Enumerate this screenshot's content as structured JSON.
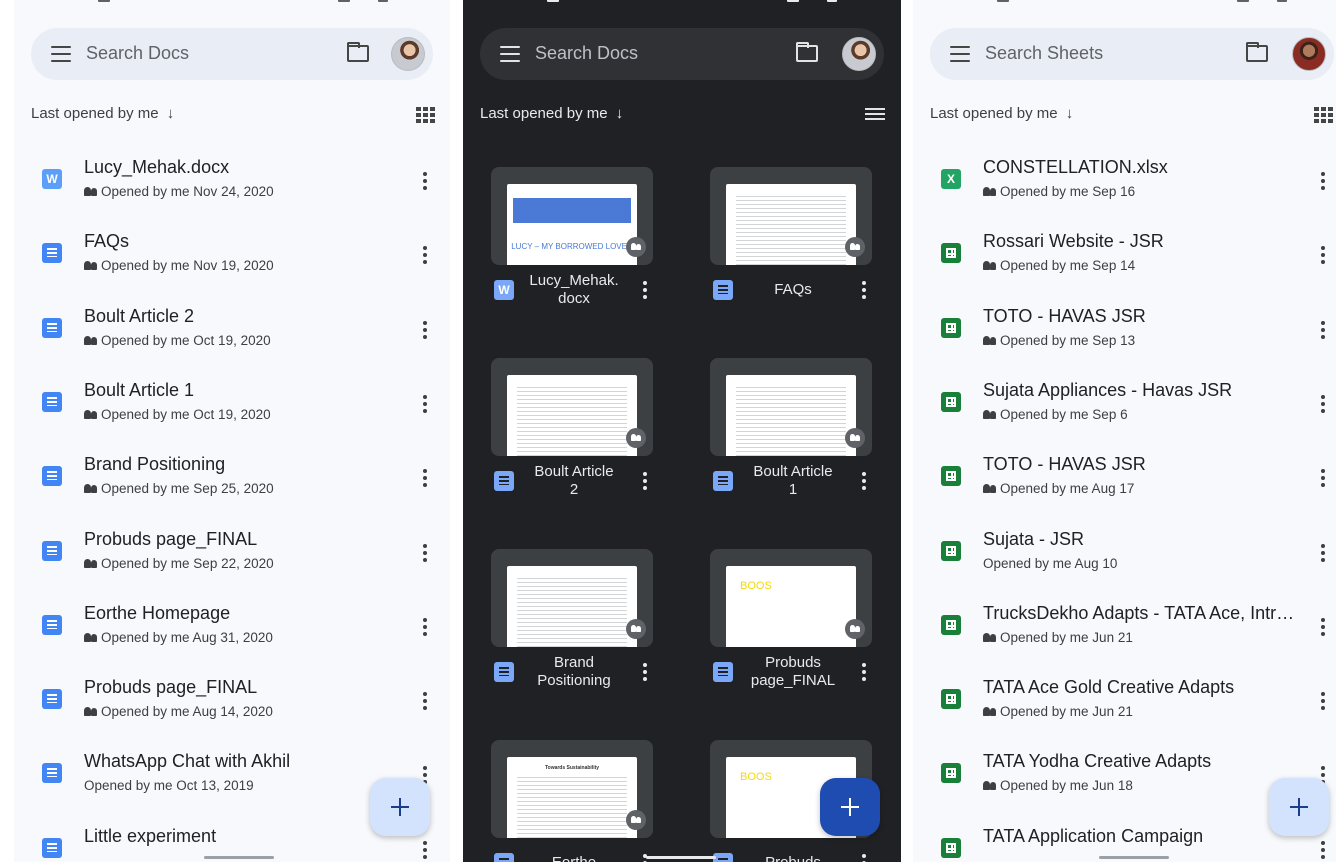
{
  "panel1": {
    "search_placeholder": "Search Docs",
    "sort_label": "Last opened by me",
    "sort_arrow": "↓",
    "files": [
      {
        "title": "Lucy_Mehak.docx",
        "subtitle": "Opened by me Nov 24, 2020",
        "icon": "word-icon",
        "icon_letter": "W",
        "shared": true
      },
      {
        "title": "FAQs",
        "subtitle": "Opened by me Nov 19, 2020",
        "icon": "doc-icon",
        "shared": true
      },
      {
        "title": "Boult Article 2",
        "subtitle": "Opened by me Oct 19, 2020",
        "icon": "doc-icon",
        "shared": true
      },
      {
        "title": "Boult Article 1",
        "subtitle": "Opened by me Oct 19, 2020",
        "icon": "doc-icon",
        "shared": true
      },
      {
        "title": "Brand Positioning",
        "subtitle": "Opened by me Sep 25, 2020",
        "icon": "doc-icon",
        "shared": true
      },
      {
        "title": "Probuds page_FINAL",
        "subtitle": "Opened by me Sep 22, 2020",
        "icon": "doc-icon",
        "shared": true
      },
      {
        "title": "Eorthe Homepage",
        "subtitle": "Opened by me Aug 31, 2020",
        "icon": "doc-icon",
        "shared": true
      },
      {
        "title": "Probuds page_FINAL",
        "subtitle": "Opened by me Aug 14, 2020",
        "icon": "doc-icon",
        "shared": true
      },
      {
        "title": "WhatsApp Chat with Akhil",
        "subtitle": "Opened by me Oct 13, 2019",
        "icon": "doc-icon",
        "shared": false
      },
      {
        "title": "Little experiment",
        "subtitle": "",
        "icon": "doc-icon",
        "shared": true
      }
    ]
  },
  "panel2": {
    "search_placeholder": "Search Docs",
    "sort_label": "Last opened by me",
    "sort_arrow": "↓",
    "cards": [
      {
        "title_lines": [
          "Lucy_Mehak.",
          "docx"
        ],
        "icon_letter": "W",
        "icon": "word-icon",
        "thumb_caption": "LUCY – MY BORROWED LOVER"
      },
      {
        "title_lines": [
          "FAQs"
        ],
        "icon": "doc-icon"
      },
      {
        "title_lines": [
          "Boult Article",
          "2"
        ],
        "icon": "doc-icon"
      },
      {
        "title_lines": [
          "Boult Article",
          "1"
        ],
        "icon": "doc-icon"
      },
      {
        "title_lines": [
          "Brand",
          "Positioning"
        ],
        "icon": "doc-icon"
      },
      {
        "title_lines": [
          "Probuds",
          "page_FINAL"
        ],
        "icon": "doc-icon",
        "thumb_text": "BOOS"
      },
      {
        "title_lines": [
          "Eorthe"
        ],
        "icon": "doc-icon",
        "thumb_heading": "Towards Sustainability"
      },
      {
        "title_lines": [
          "Probuds"
        ],
        "icon": "doc-icon",
        "thumb_text": "BOOS"
      }
    ]
  },
  "panel3": {
    "search_placeholder": "Search Sheets",
    "sort_label": "Last opened by me",
    "sort_arrow": "↓",
    "files": [
      {
        "title": "CONSTELLATION.xlsx",
        "subtitle": "Opened by me Sep 16",
        "icon": "excel-icon",
        "icon_letter": "X",
        "shared": true
      },
      {
        "title": "Rossari Website - JSR",
        "subtitle": "Opened by me Sep 14",
        "icon": "sheet-icon",
        "shared": true
      },
      {
        "title": "TOTO - HAVAS JSR",
        "subtitle": "Opened by me Sep 13",
        "icon": "sheet-icon",
        "shared": true
      },
      {
        "title": "Sujata Appliances - Havas JSR",
        "subtitle": "Opened by me Sep 6",
        "icon": "sheet-icon",
        "shared": true
      },
      {
        "title": "TOTO - HAVAS JSR",
        "subtitle": "Opened by me Aug 17",
        "icon": "sheet-icon",
        "shared": true
      },
      {
        "title": "Sujata - JSR",
        "subtitle": "Opened by me Aug 10",
        "icon": "sheet-icon",
        "shared": false
      },
      {
        "title": "TrucksDekho Adapts - TATA Ace, Intra ...",
        "subtitle": "Opened by me Jun 21",
        "icon": "sheet-icon",
        "shared": true
      },
      {
        "title": "TATA Ace Gold Creative Adapts",
        "subtitle": "Opened by me Jun 21",
        "icon": "sheet-icon",
        "shared": true
      },
      {
        "title": "TATA Yodha Creative Adapts",
        "subtitle": "Opened by me Jun 18",
        "icon": "sheet-icon",
        "shared": true
      },
      {
        "title": "TATA Application Campaign",
        "subtitle": "",
        "icon": "sheet-icon",
        "shared": true
      }
    ]
  },
  "colors": {
    "light_bg": "#f8f9fc",
    "dark_bg": "#202124",
    "docs_blue": "#4285f4",
    "sheets_green": "#188038",
    "fab_light": "#d3e3fd",
    "fab_dark": "#1f4cb0"
  }
}
